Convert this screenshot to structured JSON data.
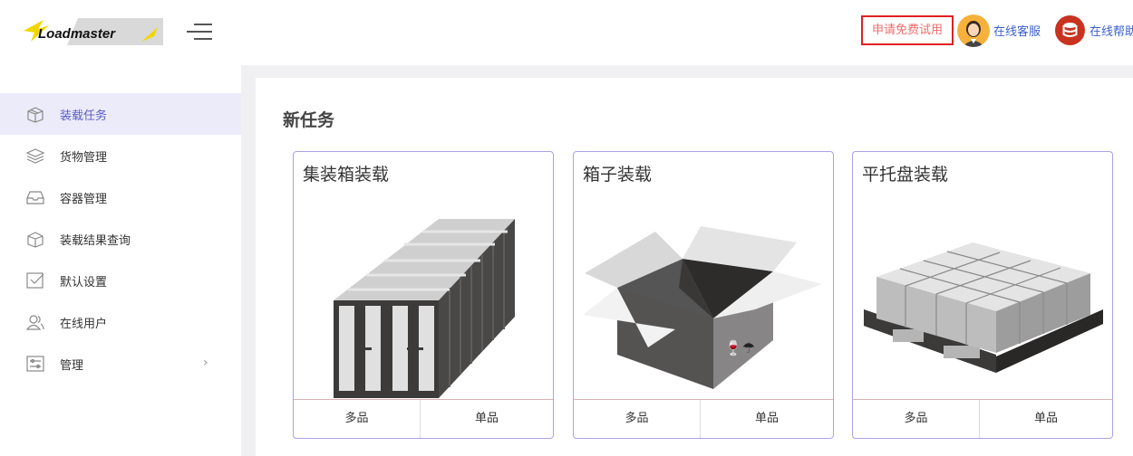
{
  "header": {
    "logo_text": "Loadmaster",
    "trial_button": "申请免费试用",
    "customer_service": "在线客服",
    "help": "在线帮助"
  },
  "sidebar": {
    "items": [
      {
        "label": "装载任务",
        "icon": "box-icon",
        "active": true
      },
      {
        "label": "货物管理",
        "icon": "layers-icon"
      },
      {
        "label": "容器管理",
        "icon": "tray-icon"
      },
      {
        "label": "装载结果查询",
        "icon": "box-search-icon"
      },
      {
        "label": "默认设置",
        "icon": "checkbox-icon"
      },
      {
        "label": "在线用户",
        "icon": "users-icon"
      },
      {
        "label": "管理",
        "icon": "settings-panel-icon",
        "has_submenu": true
      }
    ]
  },
  "main": {
    "section_title": "新任务",
    "cards": [
      {
        "title": "集装箱装载",
        "illustration": "shipping-container",
        "buttons": [
          "多品",
          "单品"
        ]
      },
      {
        "title": "箱子装载",
        "illustration": "open-box",
        "buttons": [
          "多品",
          "单品"
        ]
      },
      {
        "title": "平托盘装载",
        "illustration": "pallet",
        "buttons": [
          "多品",
          "单品"
        ]
      }
    ]
  },
  "colors": {
    "accent": "#5a5ac8",
    "active_bg": "#ebebf9",
    "trial_border": "#e02020",
    "card_border": "#a9a3e6",
    "link": "#3a5fcf"
  }
}
